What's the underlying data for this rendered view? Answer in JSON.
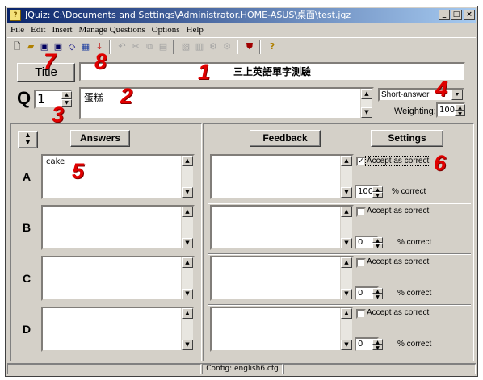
{
  "window": {
    "title": "JQuiz: C:\\Documents and Settings\\Administrator.HOME-ASUS\\桌面\\test.jqz"
  },
  "menu": [
    "File",
    "Edit",
    "Insert",
    "Manage Questions",
    "Options",
    "Help"
  ],
  "header": {
    "title_button": "Title",
    "title_value": "三上英語單字測驗",
    "q_label": "Q",
    "q_number": "1",
    "question_text": "蛋糕",
    "question_type": "Short-answer",
    "weighting_label": "Weighting:",
    "weighting_value": "100"
  },
  "columns": {
    "answers": "Answers",
    "feedback": "Feedback",
    "settings": "Settings"
  },
  "rows": [
    {
      "letter": "A",
      "answer": "cake",
      "feedback": "",
      "accept_label": "Accept as correct",
      "accept_checked": true,
      "percent": "100",
      "percent_label": "% correct"
    },
    {
      "letter": "B",
      "answer": "",
      "feedback": "",
      "accept_label": "Accept as correct",
      "accept_checked": false,
      "percent": "0",
      "percent_label": "% correct"
    },
    {
      "letter": "C",
      "answer": "",
      "feedback": "",
      "accept_label": "Accept as correct",
      "accept_checked": false,
      "percent": "0",
      "percent_label": "% correct"
    },
    {
      "letter": "D",
      "answer": "",
      "feedback": "",
      "accept_label": "Accept as correct",
      "accept_checked": false,
      "percent": "0",
      "percent_label": "% correct"
    }
  ],
  "annotations": {
    "n1": "1",
    "n2": "2",
    "n3": "3",
    "n4": "4",
    "n5": "5",
    "n6": "6",
    "n7": "7",
    "n8": "8"
  },
  "status": {
    "config": "Config: english6.cfg"
  }
}
